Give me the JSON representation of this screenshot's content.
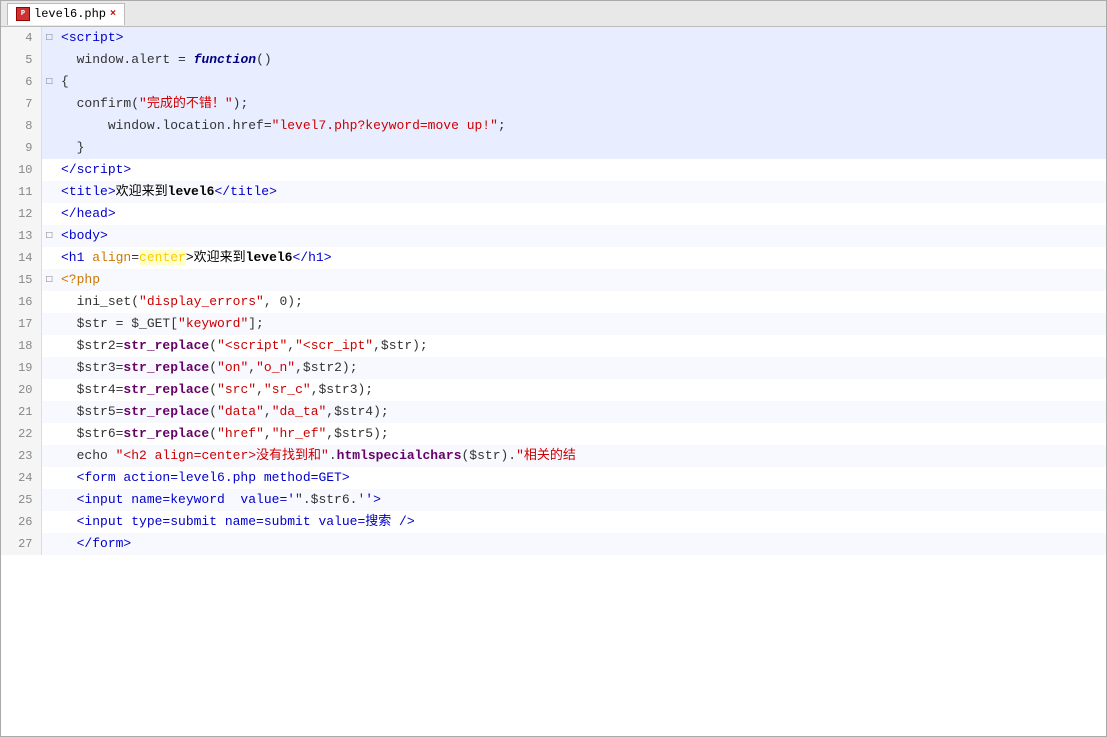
{
  "window": {
    "title": "level6.php"
  },
  "tab": {
    "label": "level6.php",
    "close": "×"
  },
  "lines": [
    {
      "num": 4,
      "fold": "□",
      "highlighted": true,
      "segments": [
        {
          "text": "<",
          "class": "kw-tag"
        },
        {
          "text": "script",
          "class": "kw-tag"
        },
        {
          "text": ">",
          "class": "kw-tag"
        }
      ]
    },
    {
      "num": 5,
      "fold": "",
      "highlighted": true,
      "segments": [
        {
          "text": "window.alert = ",
          "class": "kw-plain"
        },
        {
          "text": "function",
          "class": "kw-func"
        },
        {
          "text": "()",
          "class": "kw-plain"
        }
      ]
    },
    {
      "num": 6,
      "fold": "□",
      "highlighted": true,
      "segments": [
        {
          "text": "{",
          "class": "kw-plain"
        }
      ]
    },
    {
      "num": 7,
      "fold": "",
      "highlighted": true,
      "segments": [
        {
          "text": "confirm(",
          "class": "kw-plain"
        },
        {
          "text": "\"完成的不错！\"",
          "class": "kw-str"
        },
        {
          "text": ");",
          "class": "kw-plain"
        }
      ]
    },
    {
      "num": 8,
      "fold": "",
      "highlighted": true,
      "segments": [
        {
          "text": "  window.location.href=",
          "class": "kw-plain"
        },
        {
          "text": "\"level7.php?keyword=move up!\"",
          "class": "kw-str"
        },
        {
          "text": ";",
          "class": "kw-plain"
        }
      ]
    },
    {
      "num": 9,
      "fold": "",
      "highlighted": true,
      "segments": [
        {
          "text": "}",
          "class": "kw-plain"
        }
      ]
    },
    {
      "num": 10,
      "fold": "",
      "highlighted": false,
      "segments": [
        {
          "text": "<",
          "class": "kw-tag"
        },
        {
          "text": "/script",
          "class": "kw-tag"
        },
        {
          "text": ">",
          "class": "kw-tag"
        }
      ]
    },
    {
      "num": 11,
      "fold": "",
      "highlighted": false,
      "segments": [
        {
          "text": "<",
          "class": "kw-tag"
        },
        {
          "text": "title",
          "class": "kw-tag"
        },
        {
          "text": ">",
          "class": "kw-tag"
        },
        {
          "text": "欢迎来到",
          "class": "kw-cn"
        },
        {
          "text": "level6",
          "class": "kw-bold"
        },
        {
          "text": "</",
          "class": "kw-tag"
        },
        {
          "text": "title",
          "class": "kw-tag"
        },
        {
          "text": ">",
          "class": "kw-tag"
        }
      ]
    },
    {
      "num": 12,
      "fold": "",
      "highlighted": false,
      "segments": [
        {
          "text": "</",
          "class": "kw-tag"
        },
        {
          "text": "head",
          "class": "kw-tag"
        },
        {
          "text": ">",
          "class": "kw-tag"
        }
      ]
    },
    {
      "num": 13,
      "fold": "□",
      "highlighted": false,
      "segments": [
        {
          "text": "<",
          "class": "kw-tag"
        },
        {
          "text": "body",
          "class": "kw-tag"
        },
        {
          "text": ">",
          "class": "kw-tag"
        }
      ]
    },
    {
      "num": 14,
      "fold": "",
      "highlighted": false,
      "segments": [
        {
          "text": "<h1 ",
          "class": "kw-tag"
        },
        {
          "text": "align",
          "class": "kw-attr"
        },
        {
          "text": "=",
          "class": "kw-plain"
        },
        {
          "text": "center",
          "class": "kw-attr-val"
        },
        {
          "text": ">欢迎来到",
          "class": "kw-cn"
        },
        {
          "text": "level6",
          "class": "kw-bold"
        },
        {
          "text": "</h1>",
          "class": "kw-tag"
        }
      ]
    },
    {
      "num": 15,
      "fold": "□",
      "highlighted": false,
      "segments": [
        {
          "text": "<?php",
          "class": "kw-php"
        }
      ]
    },
    {
      "num": 16,
      "fold": "",
      "highlighted": false,
      "segments": [
        {
          "text": "ini_set(",
          "class": "kw-plain"
        },
        {
          "text": "\"display_errors\"",
          "class": "kw-str"
        },
        {
          "text": ", 0);",
          "class": "kw-plain"
        }
      ]
    },
    {
      "num": 17,
      "fold": "",
      "highlighted": false,
      "segments": [
        {
          "text": "$str = $_GET[",
          "class": "kw-plain"
        },
        {
          "text": "\"keyword\"",
          "class": "kw-str"
        },
        {
          "text": "];",
          "class": "kw-plain"
        }
      ]
    },
    {
      "num": 18,
      "fold": "",
      "highlighted": false,
      "segments": [
        {
          "text": "$str2=",
          "class": "kw-plain"
        },
        {
          "text": "str_replace",
          "class": "kw-fn"
        },
        {
          "text": "(",
          "class": "kw-plain"
        },
        {
          "text": "\"<script\"",
          "class": "kw-str"
        },
        {
          "text": ",",
          "class": "kw-plain"
        },
        {
          "text": "\"<scr_ipt\"",
          "class": "kw-str"
        },
        {
          "text": ",$str);",
          "class": "kw-plain"
        }
      ]
    },
    {
      "num": 19,
      "fold": "",
      "highlighted": false,
      "segments": [
        {
          "text": "$str3=",
          "class": "kw-plain"
        },
        {
          "text": "str_replace",
          "class": "kw-fn"
        },
        {
          "text": "(",
          "class": "kw-plain"
        },
        {
          "text": "\"on\"",
          "class": "kw-str"
        },
        {
          "text": ",",
          "class": "kw-plain"
        },
        {
          "text": "\"o_n\"",
          "class": "kw-str"
        },
        {
          "text": ",$str2);",
          "class": "kw-plain"
        }
      ]
    },
    {
      "num": 20,
      "fold": "",
      "highlighted": false,
      "segments": [
        {
          "text": "$str4=",
          "class": "kw-plain"
        },
        {
          "text": "str_replace",
          "class": "kw-fn"
        },
        {
          "text": "(",
          "class": "kw-plain"
        },
        {
          "text": "\"src\"",
          "class": "kw-str"
        },
        {
          "text": ",",
          "class": "kw-plain"
        },
        {
          "text": "\"sr_c\"",
          "class": "kw-str"
        },
        {
          "text": ",$str3);",
          "class": "kw-plain"
        }
      ]
    },
    {
      "num": 21,
      "fold": "",
      "highlighted": false,
      "segments": [
        {
          "text": "$str5=",
          "class": "kw-plain"
        },
        {
          "text": "str_replace",
          "class": "kw-fn"
        },
        {
          "text": "(",
          "class": "kw-plain"
        },
        {
          "text": "\"data\"",
          "class": "kw-str"
        },
        {
          "text": ",",
          "class": "kw-plain"
        },
        {
          "text": "\"da_ta\"",
          "class": "kw-str"
        },
        {
          "text": ",$str4);",
          "class": "kw-plain"
        }
      ]
    },
    {
      "num": 22,
      "fold": "",
      "highlighted": false,
      "segments": [
        {
          "text": "$str6=",
          "class": "kw-plain"
        },
        {
          "text": "str_replace",
          "class": "kw-fn"
        },
        {
          "text": "(",
          "class": "kw-plain"
        },
        {
          "text": "\"href\"",
          "class": "kw-str"
        },
        {
          "text": ",",
          "class": "kw-plain"
        },
        {
          "text": "\"hr_ef\"",
          "class": "kw-str"
        },
        {
          "text": ",$str5);",
          "class": "kw-plain"
        }
      ]
    },
    {
      "num": 23,
      "fold": "",
      "highlighted": false,
      "segments": [
        {
          "text": "echo ",
          "class": "kw-plain"
        },
        {
          "text": "\"<h2 align=center>没有找到和\"",
          "class": "kw-str"
        },
        {
          "text": ".",
          "class": "kw-plain"
        },
        {
          "text": "htmlspecialchars",
          "class": "kw-fn"
        },
        {
          "text": "($str).",
          "class": "kw-plain"
        },
        {
          "text": "\"相关的结",
          "class": "kw-str"
        }
      ]
    },
    {
      "num": 24,
      "fold": "",
      "highlighted": false,
      "segments": [
        {
          "text": "<form action=level6.php method=GET>",
          "class": "kw-tag"
        }
      ]
    },
    {
      "num": 25,
      "fold": "",
      "highlighted": false,
      "segments": [
        {
          "text": "<input name=keyword  value='",
          "class": "kw-tag"
        },
        {
          "text": "\".$str6.'",
          "class": "kw-plain"
        },
        {
          "text": "'>",
          "class": "kw-tag"
        }
      ]
    },
    {
      "num": 26,
      "fold": "",
      "highlighted": false,
      "segments": [
        {
          "text": "<input type=submit name=submit value=搜索 />",
          "class": "kw-tag"
        }
      ]
    },
    {
      "num": 27,
      "fold": "",
      "highlighted": false,
      "segments": [
        {
          "text": "</form>",
          "class": "kw-tag"
        }
      ]
    }
  ]
}
